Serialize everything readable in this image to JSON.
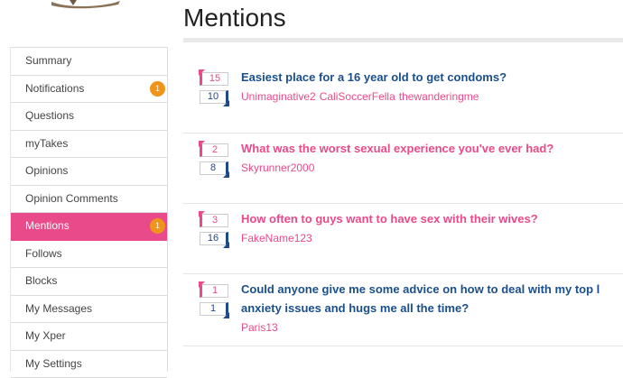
{
  "page": {
    "title": "Mentions"
  },
  "sidebar": {
    "items": [
      {
        "label": "Summary",
        "badge": null
      },
      {
        "label": "Notifications",
        "badge": "1"
      },
      {
        "label": "Questions",
        "badge": null
      },
      {
        "label": "myTakes",
        "badge": null
      },
      {
        "label": "Opinions",
        "badge": null
      },
      {
        "label": "Opinion Comments",
        "badge": null
      },
      {
        "label": "Mentions",
        "badge": "1",
        "active": true
      },
      {
        "label": "Follows",
        "badge": null
      },
      {
        "label": "Blocks",
        "badge": null
      },
      {
        "label": "My Messages",
        "badge": null
      },
      {
        "label": "My Xper",
        "badge": null
      },
      {
        "label": "My Settings",
        "badge": null
      }
    ]
  },
  "mentions": [
    {
      "up": "15",
      "down": "10",
      "title_lines": [
        "Easiest place for a 16 year old to get condoms?"
      ],
      "title_color": "blue",
      "users": [
        "Unimaginative2",
        "CaliSoccerFella",
        "thewanderingme"
      ]
    },
    {
      "up": "2",
      "down": "8",
      "title_lines": [
        "What was the worst sexual experience you've ever had?"
      ],
      "title_color": "pink",
      "users": [
        "Skyrunner2000"
      ]
    },
    {
      "up": "3",
      "down": "16",
      "title_lines": [
        "How often to guys want to have sex with their wives?"
      ],
      "title_color": "pink",
      "users": [
        "FakeName123"
      ]
    },
    {
      "up": "1",
      "down": "1",
      "title_lines": [
        "Could anyone give me some advice on how to deal with my top l",
        "anxiety issues and hugs me all the time?"
      ],
      "title_color": "blue",
      "users": [
        "Paris13"
      ]
    }
  ],
  "colors": {
    "accent_pink": "#e94a8a",
    "link_blue": "#1b4f8c",
    "badge_orange": "#f0941b"
  },
  "icons": {
    "logo": "bird-logo-icon"
  }
}
